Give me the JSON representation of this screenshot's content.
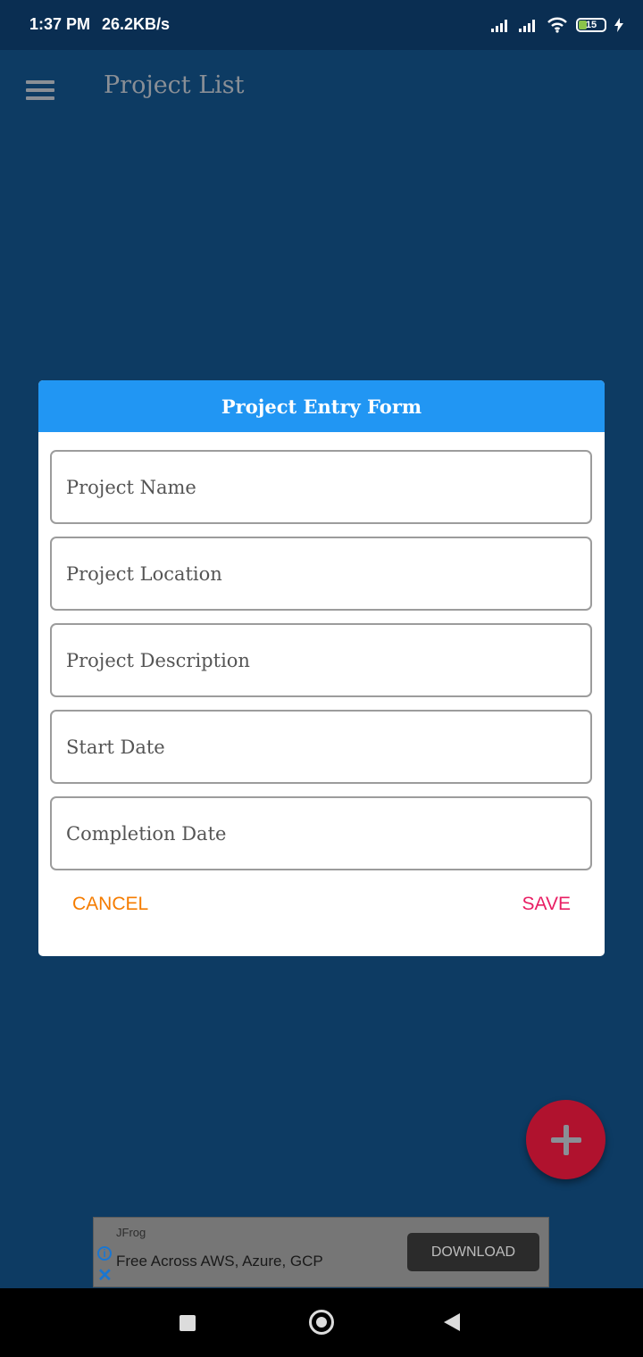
{
  "status_bar": {
    "time": "1:37 PM",
    "speed": "26.2KB/s",
    "battery": "15",
    "battery_color": "#8bc34a"
  },
  "app_bar": {
    "title": "Project List",
    "menu_icon": "hamburger-menu-icon"
  },
  "dialog": {
    "title": "Project Entry Form",
    "header_color": "#2196f3",
    "fields": [
      {
        "placeholder": "Project Name",
        "value": ""
      },
      {
        "placeholder": "Project Location",
        "value": ""
      },
      {
        "placeholder": "Project Description",
        "value": ""
      },
      {
        "placeholder": "Start Date",
        "value": ""
      },
      {
        "placeholder": "Completion Date",
        "value": ""
      }
    ],
    "cancel_label": "CANCEL",
    "cancel_color": "#f57c00",
    "save_label": "SAVE",
    "save_color": "#e91e63"
  },
  "fab": {
    "icon": "plus-icon",
    "color": "#b0122e"
  },
  "ad": {
    "brand": "JFrog",
    "text": "Free Across AWS, Azure, GCP",
    "button_label": "DOWNLOAD"
  },
  "colors": {
    "background": "#0d3b63",
    "status_bar": "#0a2e52"
  }
}
